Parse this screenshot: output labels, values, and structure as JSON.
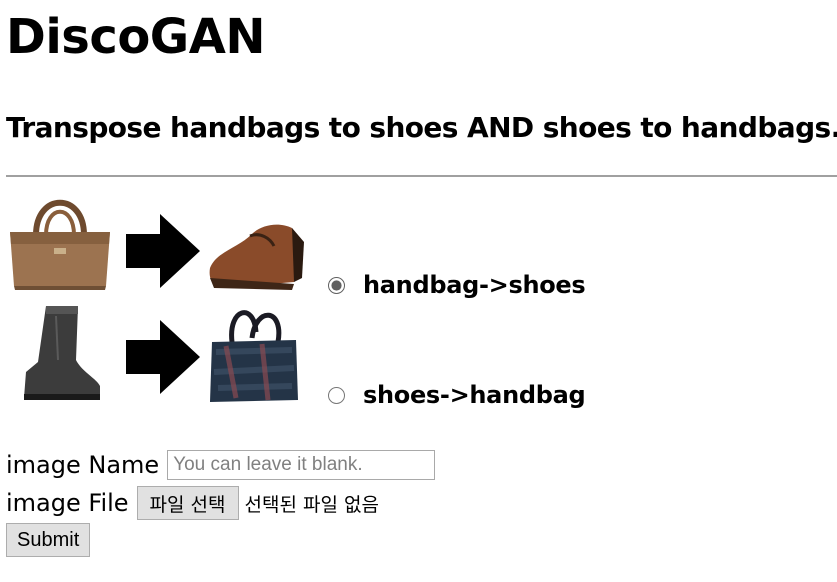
{
  "page": {
    "title": "DiscoGAN",
    "subtitle": "Transpose handbags to shoes AND shoes to handbags."
  },
  "examples": {
    "row1": {
      "source": "handbag-image",
      "target": "shoe-image"
    },
    "row2": {
      "source": "boot-image",
      "target": "handbag-image"
    },
    "arrow_icon": "right-arrow-icon"
  },
  "mode": {
    "options": [
      {
        "label": "handbag->shoes",
        "checked": true
      },
      {
        "label": "shoes->handbag",
        "checked": false
      }
    ]
  },
  "form": {
    "name_label": "image Name",
    "name_placeholder": "You can leave it blank.",
    "file_label": "image File",
    "file_button": "파일 선택",
    "file_status": "선택된 파일 없음",
    "submit_label": "Submit"
  },
  "colors": {
    "background": "#ffffff",
    "rule": "#a0a0a0",
    "button_bg": "#e1e1e1"
  }
}
